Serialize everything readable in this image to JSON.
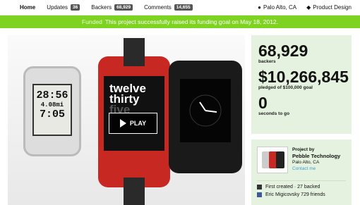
{
  "nav": {
    "home": "Home",
    "updates": "Updates",
    "updates_count": "36",
    "backers": "Backers",
    "backers_count": "68,929",
    "comments": "Comments",
    "comments_count": "14,655",
    "location": "Palo Alto, CA",
    "category": "Product Design"
  },
  "banner": {
    "label": "Funded",
    "text": "This project successfully raised its funding goal on May 18, 2012."
  },
  "video": {
    "play_label": "PLAY",
    "watch1_time": "28:56",
    "watch1_line2": "4.08",
    "watch1_unit": "mi",
    "watch1_line3": "7:05",
    "watch2_l1": "twelve",
    "watch2_l2": "thirty",
    "watch2_l3": "five"
  },
  "stats": {
    "backers_value": "68,929",
    "backers_label": "backers",
    "pledged_value": "$10,266,845",
    "pledged_label": "pledged of $100,000 goal",
    "seconds_value": "0",
    "seconds_label": "seconds to go"
  },
  "creator": {
    "project_by": "Project by",
    "name": "Pebble Technology",
    "location": "Palo Alto, CA",
    "contact": "Contact me",
    "first_created": "First created · 27 backed",
    "friend": "Eric Migicovsky 729 friends"
  },
  "colors": {
    "banner": "#7ed321",
    "stats_bg": "#e6f2e0",
    "red_watch": "#c82822",
    "link": "#3a9fd3"
  }
}
